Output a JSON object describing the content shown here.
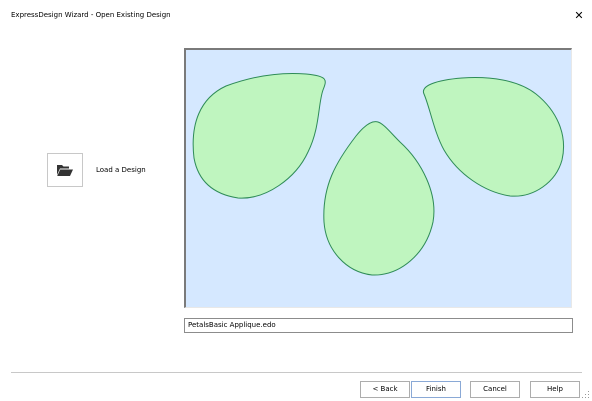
{
  "window": {
    "title": "ExpressDesign Wizard - Open Existing Design",
    "close_glyph": "✕"
  },
  "load": {
    "icon": "folder-open-icon",
    "label": "Load a Design"
  },
  "preview": {
    "background_color": "#d5e8ff",
    "petal_fill": "#bff5bf",
    "petal_stroke": "#2e8b57"
  },
  "filename": {
    "value": "PetalsBasic Applique.edo"
  },
  "buttons": {
    "back": "< Back",
    "finish": "Finish",
    "cancel": "Cancel",
    "help": "Help"
  }
}
